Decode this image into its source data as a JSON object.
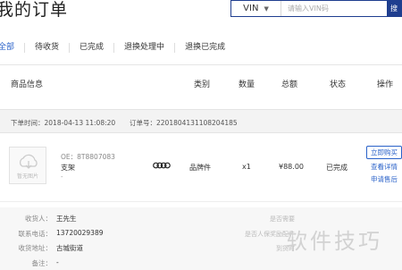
{
  "header": {
    "title": "我的订单",
    "search": {
      "select_value": "VIN",
      "placeholder": "请输入VIN码",
      "button_label": "搜"
    }
  },
  "tabs": [
    {
      "label": "全部"
    },
    {
      "label": "待收货"
    },
    {
      "label": "已完成"
    },
    {
      "label": "退换处理中"
    },
    {
      "label": "退换已完成"
    }
  ],
  "table_headers": [
    "商品信息",
    "类别",
    "数量",
    "总额",
    "状态",
    "操作"
  ],
  "order": {
    "time_label": "下单时间：",
    "time": "2018-04-13 11:08:20",
    "id_label": "订单号：",
    "id": "2201804131108204185",
    "item": {
      "thumb_label": "暂无图片",
      "oe_label": "OE：",
      "oe": "8T8807083",
      "name": "支架",
      "extra": "-",
      "category": "品牌件",
      "quantity": "x1",
      "total": "¥88.00",
      "status": "已完成",
      "buy_label": "立即购买",
      "details_label": "查看详情",
      "aftersale_label": "申请售后"
    }
  },
  "delivery": [
    {
      "key": "收货人：",
      "value": "王先生"
    },
    {
      "key": "联系电话：",
      "value": "13720029389"
    },
    {
      "key": "收货地址：",
      "value": "古城街道"
    },
    {
      "key": "备注：",
      "value": "-"
    }
  ],
  "delivery_right": [
    "是否需要",
    "是否人保奖励配件",
    "到货时"
  ],
  "watermark": "软件技巧",
  "colors": {
    "accent": "#2a62c9",
    "search_border": "#1f3e8f"
  }
}
